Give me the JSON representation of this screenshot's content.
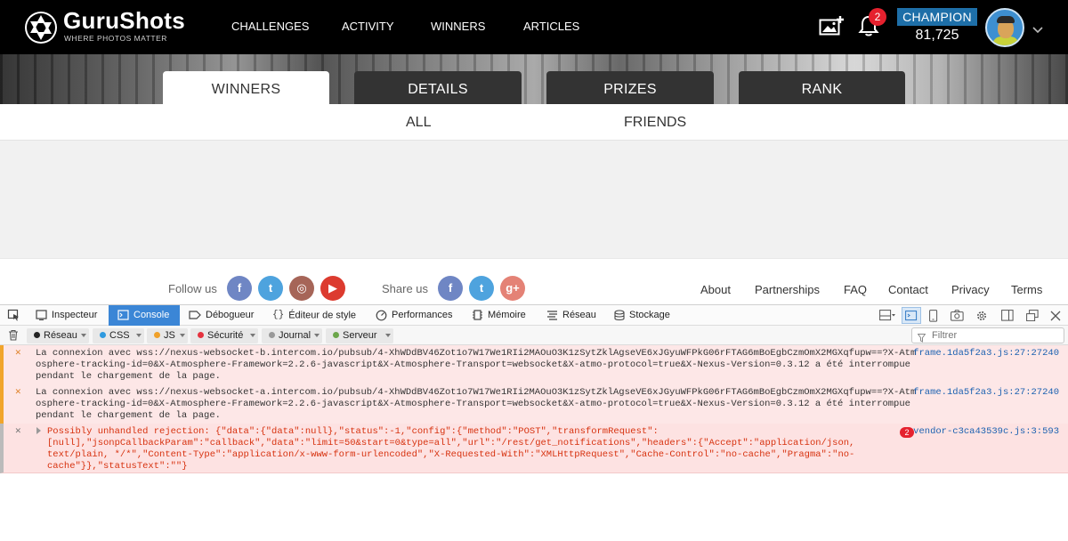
{
  "header": {
    "brand": "GuruShots",
    "tagline": "WHERE PHOTOS MATTER",
    "nav": [
      {
        "label": "CHALLENGES"
      },
      {
        "label": "ACTIVITY"
      },
      {
        "label": "WINNERS"
      },
      {
        "label": "ARTICLES"
      }
    ],
    "notification_count": "2",
    "rank": "CHAMPION",
    "points": "81,725",
    "icons": [
      "upload-photo-icon",
      "bell-icon",
      "chevron-down-icon"
    ]
  },
  "tabs": [
    {
      "label": "WINNERS",
      "active": true
    },
    {
      "label": "DETAILS",
      "active": false
    },
    {
      "label": "PRIZES",
      "active": false
    },
    {
      "label": "RANK",
      "active": false
    }
  ],
  "subtabs": [
    {
      "label": "ALL"
    },
    {
      "label": "FRIENDS"
    }
  ],
  "footer": {
    "follow_label": "Follow us",
    "share_label": "Share us",
    "follow": [
      {
        "network": "facebook",
        "glyph": "f",
        "color": "#6f86c4"
      },
      {
        "network": "twitter",
        "glyph": "t",
        "color": "#4ea3de"
      },
      {
        "network": "instagram",
        "glyph": "◎",
        "color": "#a66558"
      },
      {
        "network": "youtube",
        "glyph": "▶",
        "color": "#dc3b2f"
      }
    ],
    "share": [
      {
        "network": "facebook",
        "glyph": "f",
        "color": "#6f86c4"
      },
      {
        "network": "twitter",
        "glyph": "t",
        "color": "#4ea3de"
      },
      {
        "network": "google-plus",
        "glyph": "g+",
        "color": "#e48276"
      }
    ],
    "links": [
      {
        "label": "About"
      },
      {
        "label": "Partnerships"
      },
      {
        "label": "FAQ"
      },
      {
        "label": "Contact"
      },
      {
        "label": "Privacy"
      },
      {
        "label": "Terms"
      }
    ]
  },
  "devtools": {
    "tabs": [
      {
        "label": "Inspecteur",
        "icon": "inspector-icon",
        "active": false
      },
      {
        "label": "Console",
        "icon": "console-icon",
        "active": true
      },
      {
        "label": "Débogueur",
        "icon": "debugger-icon",
        "active": false
      },
      {
        "label": "Éditeur de style",
        "icon": "style-editor-icon",
        "active": false
      },
      {
        "label": "Performances",
        "icon": "performance-icon",
        "active": false
      },
      {
        "label": "Mémoire",
        "icon": "memory-icon",
        "active": false
      },
      {
        "label": "Réseau",
        "icon": "network-icon",
        "active": false
      },
      {
        "label": "Stockage",
        "icon": "storage-icon",
        "active": false
      }
    ],
    "filters": [
      {
        "label": "Réseau",
        "color": "#222222"
      },
      {
        "label": "CSS",
        "color": "#2e9adf"
      },
      {
        "label": "JS",
        "color": "#f0a12a"
      },
      {
        "label": "Sécurité",
        "color": "#e5333f"
      },
      {
        "label": "Journal",
        "color": "#999999"
      },
      {
        "label": "Serveur",
        "color": "#6ba64a"
      }
    ],
    "filter_placeholder": "Filtrer",
    "messages": [
      {
        "level": "warning",
        "text": "La connexion avec wss://nexus-websocket-b.intercom.io/pubsub/4-XhWDdBV46Zot1o7W17We1RIi2MAOuO3K1zSytZklAgseVE6xJGyuWFPkG06rFTAG6mBoEgbCzmOmX2MGXqfupw==?X-Atmosphere-tracking-id=0&X-Atmosphere-Framework=2.2.6-javascript&X-Atmosphere-Transport=websocket&X-atmo-protocol=true&X-Nexus-Version=0.3.12 a été interrompue pendant le chargement de la page.",
        "source": "frame.1da5f2a3.js:27:27240"
      },
      {
        "level": "warning",
        "text": "La connexion avec wss://nexus-websocket-a.intercom.io/pubsub/4-XhWDdBV46Zot1o7W17We1RIi2MAOuO3K1zSytZklAgseVE6xJGyuWFPkG06rFTAG6mBoEgbCzmOmX2MGXqfupw==?X-Atmosphere-tracking-id=0&X-Atmosphere-Framework=2.2.6-javascript&X-Atmosphere-Transport=websocket&X-atmo-protocol=true&X-Nexus-Version=0.3.12 a été interrompue pendant le chargement de la page.",
        "source": "frame.1da5f2a3.js:27:27240"
      },
      {
        "level": "error",
        "text": "Possibly unhandled rejection: {\"data\":{\"data\":null},\"status\":-1,\"config\":{\"method\":\"POST\",\"transformRequest\":\n[null],\"jsonpCallbackParam\":\"callback\",\"data\":\"limit=50&start=0&type=all\",\"url\":\"/rest/get_notifications\",\"headers\":{\"Accept\":\"application/json,\ntext/plain, */*\",\"Content-Type\":\"application/x-www-form-urlencoded\",\"X-Requested-With\":\"XMLHttpRequest\",\"Cache-Control\":\"no-cache\",\"Pragma\":\"no-\ncache\"}},\"statusText\":\"\"}",
        "count": "2",
        "source": "vendor-c3ca43539c.js:3:593"
      }
    ]
  }
}
